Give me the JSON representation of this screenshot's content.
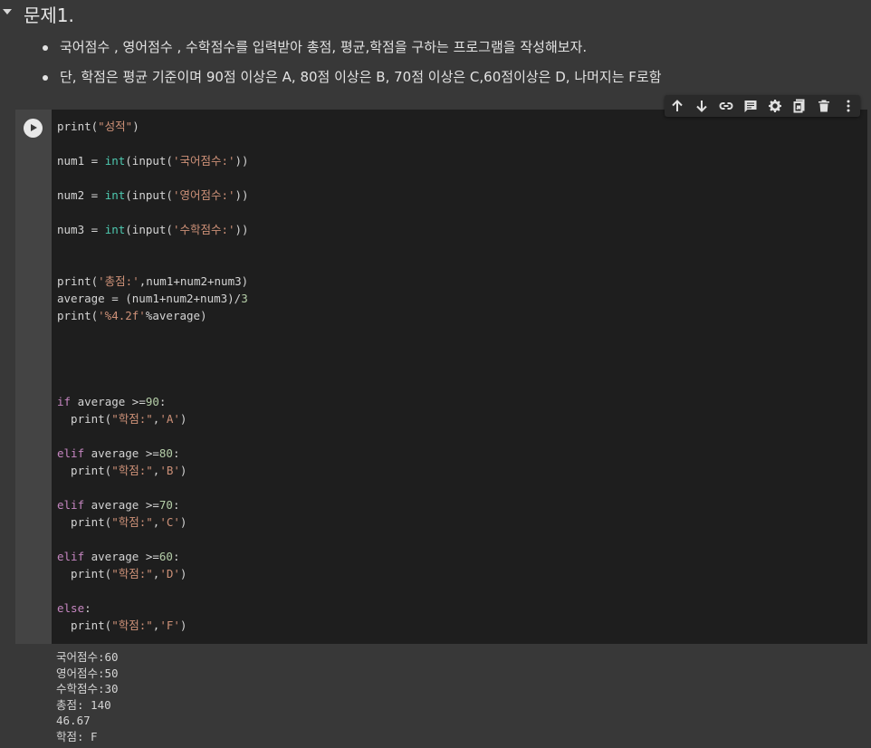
{
  "section": {
    "title": "문제1."
  },
  "bullets": [
    "국어점수 , 영어점수 , 수학점수를 입력받아 총점, 평균,학점을 구하는 프로그램을 작성해보자.",
    "단, 학점은 평균 기준이며 90점 이상은 A, 80점 이상은 B, 70점 이상은 C,60점이상은 D, 나머지는 F로함"
  ],
  "toolbar": {
    "icons": [
      "arrow-up-icon",
      "arrow-down-icon",
      "link-icon",
      "comment-icon",
      "gear-icon",
      "mirror-cell-icon",
      "trash-icon",
      "more-vert-icon"
    ]
  },
  "code": {
    "lines": [
      "print(\"성적\")",
      "",
      "num1 = int(input('국어점수:'))",
      "",
      "num2 = int(input('영어점수:'))",
      "",
      "num3 = int(input('수학점수:'))",
      "",
      "",
      "print('총점:',num1+num2+num3)",
      "average = (num1+num2+num3)/3",
      "print('%4.2f'%average)",
      "",
      "",
      "",
      "",
      "if average >=90:",
      "  print(\"학점:\",'A')",
      "",
      "elif average >=80:",
      "  print(\"학점:\",'B')",
      "",
      "elif average >=70:",
      "  print(\"학점:\",'C')",
      "",
      "elif average >=60:",
      "  print(\"학점:\",'D')",
      "",
      "else:",
      "  print(\"학점:\",'F')"
    ]
  },
  "output": {
    "lines": [
      "국어점수:60",
      "영어점수:50",
      "수학점수:30",
      "총점: 140",
      "46.67",
      "학점: F"
    ]
  },
  "colors": {
    "keyword": "#c586c0",
    "builtin": "#4ec9b0",
    "string": "#ce9178",
    "number": "#b5cea8",
    "code_bg": "#1e1e1e",
    "page_bg": "#383838"
  }
}
